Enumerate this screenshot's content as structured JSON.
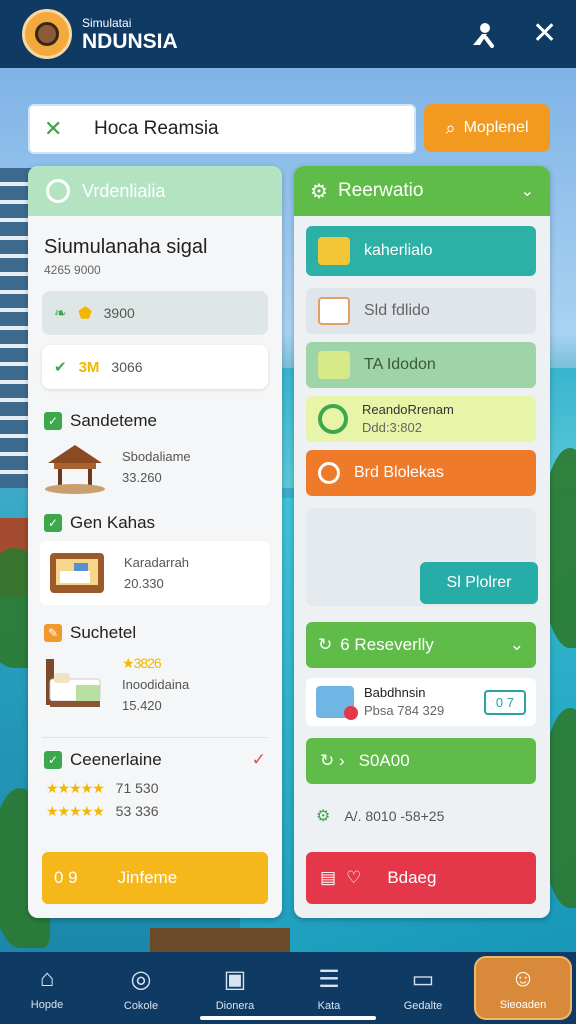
{
  "header": {
    "brand_small": "Simulatai",
    "brand_big": "NDUNSIA",
    "icons": [
      "map-pin-icon",
      "close-icon"
    ]
  },
  "search": {
    "value": "Hoca Reamsia",
    "clear_icon": "close-icon"
  },
  "map_button": {
    "label": "Moplenel",
    "icon": "search-icon"
  },
  "left_panel": {
    "title": "Vrdenlialia",
    "subtitle": "Siumulanaha sigal",
    "subtitle_value": "4265 9000",
    "rows": [
      {
        "value": "3900"
      },
      {
        "badge": "3M",
        "value": "3066"
      }
    ],
    "sections": [
      {
        "title": "Sandeteme",
        "name": "Sbodaliame",
        "price": "33.260"
      },
      {
        "title": "Gen Kahas",
        "name": "Karadarrah",
        "price": "20.330"
      },
      {
        "title": "Suchetel",
        "rating": "3826",
        "name": "Inoodidaina",
        "price": "15.420"
      }
    ],
    "reviews": {
      "title": "Ceenerlaine",
      "r1": "71 530",
      "r2": "53 336"
    },
    "cta": {
      "num": "0 9",
      "label": "Jinfeme"
    }
  },
  "right_panel": {
    "title": "Reerwatio",
    "rows": [
      {
        "label": "kaherlialo"
      },
      {
        "label": "Sld fdlido"
      },
      {
        "label": "TA Idodon"
      },
      {
        "label": "ReandoRrenam",
        "sub": "Ddd:3:802"
      },
      {
        "label": "Brd Blolekas"
      }
    ],
    "action_button": "Sl Plolrer",
    "section2_title": "6 Reseverlly",
    "booking": {
      "name": "Babdhnsin",
      "price": "Pbsa 784 329",
      "badge": "0 7"
    },
    "status": "S0A00",
    "info": "A/. 8010 -58+25",
    "danger_button": "Bdaeg"
  },
  "tabs": [
    {
      "label": "Hopde",
      "icon": "home-icon"
    },
    {
      "label": "Cokole",
      "icon": "chat-icon"
    },
    {
      "label": "Dionera",
      "icon": "tv-icon"
    },
    {
      "label": "Kata",
      "icon": "list-icon"
    },
    {
      "label": "Gedalte",
      "icon": "wallet-icon"
    },
    {
      "label": "Sieoaden",
      "icon": "user-icon"
    }
  ],
  "colors": {
    "header": "#0f3a64",
    "accent_green": "#5fbc49",
    "accent_orange": "#f29a1f",
    "danger": "#e5374a",
    "teal": "#26ada8"
  }
}
